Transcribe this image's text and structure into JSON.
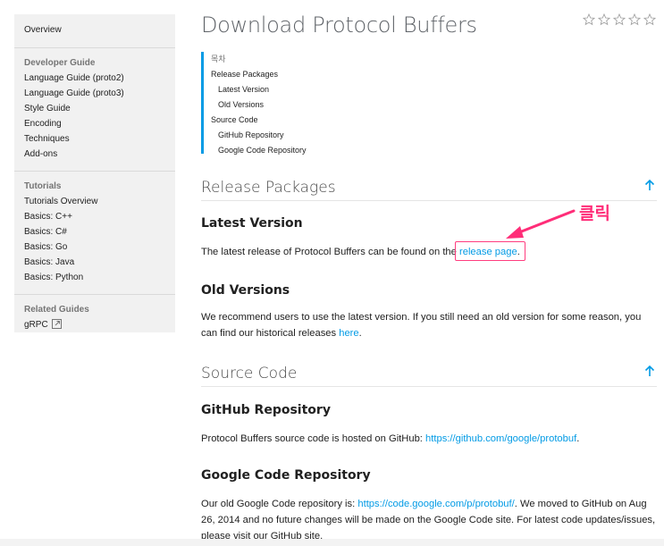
{
  "sidebar": {
    "overview": "Overview",
    "developer_guide": {
      "heading": "Developer Guide",
      "items": [
        "Language Guide (proto2)",
        "Language Guide (proto3)",
        "Style Guide",
        "Encoding",
        "Techniques",
        "Add-ons"
      ]
    },
    "tutorials": {
      "heading": "Tutorials",
      "items": [
        "Tutorials Overview",
        "Basics: C++",
        "Basics: C#",
        "Basics: Go",
        "Basics: Java",
        "Basics: Python"
      ]
    },
    "related": {
      "heading": "Related Guides",
      "items": [
        "gRPC"
      ]
    }
  },
  "page": {
    "title": "Download Protocol Buffers",
    "rating_icon": "star-outline-icon",
    "rating_stars": 5
  },
  "toc": {
    "title": "목차",
    "items": [
      "Release Packages",
      "Latest Version",
      "Old Versions",
      "Source Code",
      "GitHub Repository",
      "Google Code Repository"
    ]
  },
  "sections": {
    "release_packages": "Release Packages",
    "latest_version": "Latest Version",
    "latest_text": "The latest release of Protocol Buffers can be found on the ",
    "latest_link": "release page",
    "latest_end": ".",
    "old_versions": "Old Versions",
    "old_text": "We recommend users to use the latest version. If you still need an old version for some reason, you can find our historical releases ",
    "old_link": "here",
    "old_end": ".",
    "source_code": "Source Code",
    "github_repo": "GitHub Repository",
    "github_text": "Protocol Buffers source code is hosted on GitHub: ",
    "github_link": "https://github.com/google/protobuf",
    "github_end": ".",
    "google_code_repo": "Google Code Repository",
    "gc_text1": "Our old Google Code repository is: ",
    "gc_link": "https://code.google.com/p/protobuf/",
    "gc_text2": ". We moved to GitHub on Aug 26, 2014 and no future changes will be made on the Google Code site. For latest code updates/issues, please visit our GitHub site."
  },
  "annotation": {
    "label": "클릭",
    "color": "#ff2d78"
  },
  "colors": {
    "link": "#039be5",
    "accent_bar": "#039be5",
    "sidebar_bg": "#f1f1f1"
  }
}
